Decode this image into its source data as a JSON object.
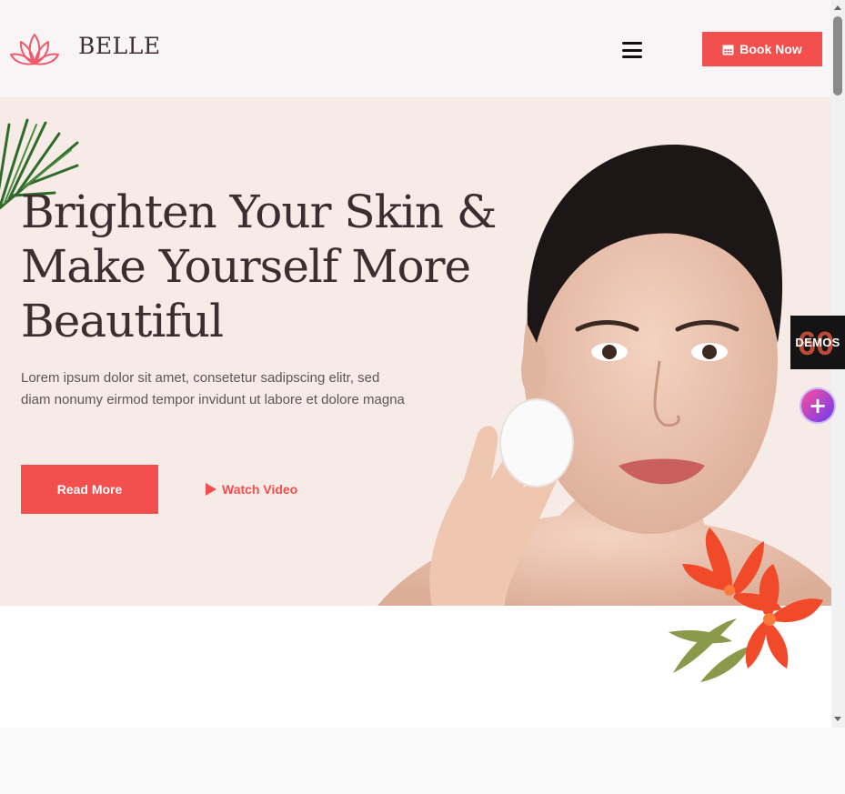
{
  "brand": {
    "name": "BELLE",
    "logo_icon": "lotus-icon",
    "accent": "#f44f4f"
  },
  "header": {
    "menu_icon": "hamburger-icon",
    "book_label": "Book Now",
    "book_icon": "calendar-icon"
  },
  "hero": {
    "title": "Brighten Your Skin & Make Yourself More Beautiful",
    "description": "Lorem ipsum dolor sit amet, consetetur sadipscing elitr, sed diam nonumy eirmod tempor invidunt ut labore et dolore magna",
    "read_more_label": "Read More",
    "watch_video_label": "Watch Video",
    "watch_icon": "play-icon",
    "background": "#f6ebe6"
  },
  "side_widgets": {
    "demos_count": "60",
    "demos_label": "DEMOS",
    "plus_label": "+"
  }
}
